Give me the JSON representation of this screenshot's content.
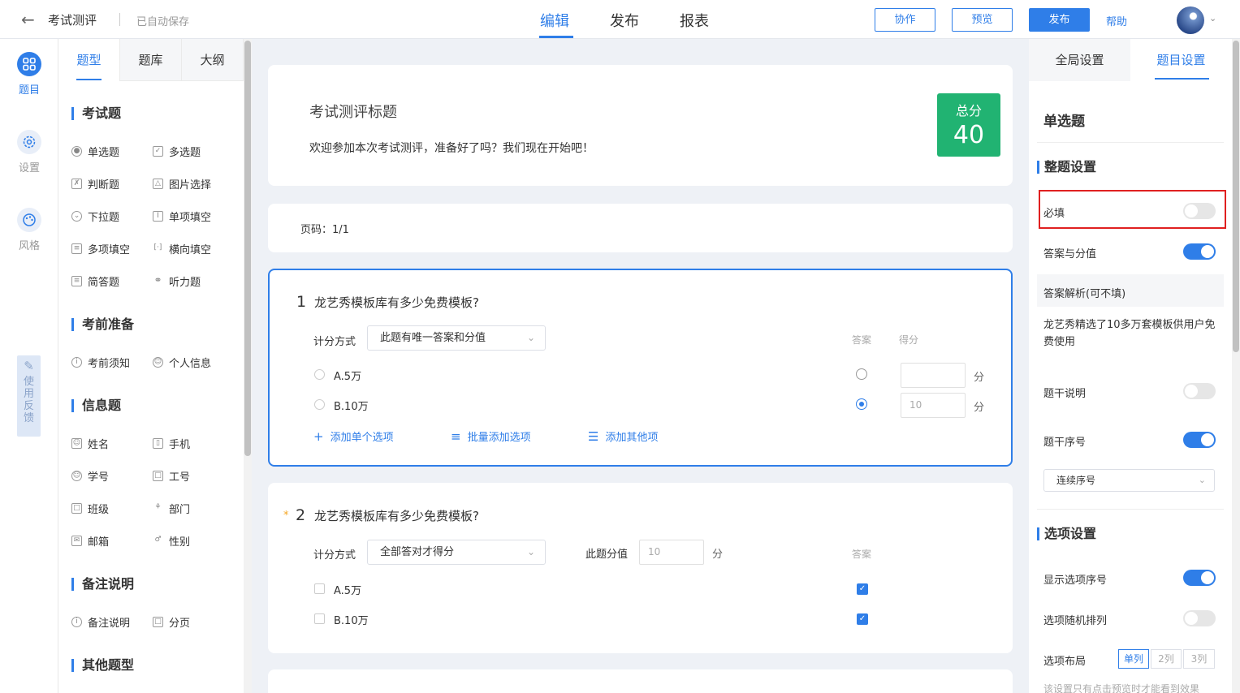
{
  "header": {
    "title": "考试测评",
    "saved": "已自动保存",
    "tabs": [
      "编辑",
      "发布",
      "报表"
    ],
    "buttons": {
      "collab": "协作",
      "preview": "预览",
      "publish": "发布",
      "help": "帮助"
    },
    "accent": "#2f7ee8"
  },
  "rail": {
    "items": [
      {
        "label": "题目"
      },
      {
        "label": "设置"
      },
      {
        "label": "风格"
      }
    ],
    "feedback": "使用反馈"
  },
  "qpanel": {
    "tabs": [
      "题型",
      "题库",
      "大纲"
    ],
    "sections": [
      {
        "title": "考试题",
        "items": [
          "单选题",
          "多选题",
          "判断题",
          "图片选择",
          "下拉题",
          "单项填空",
          "多项填空",
          "横向填空",
          "简答题",
          "听力题"
        ]
      },
      {
        "title": "考前准备",
        "items": [
          "考前须知",
          "个人信息"
        ]
      },
      {
        "title": "信息题",
        "items": [
          "姓名",
          "手机",
          "学号",
          "工号",
          "班级",
          "部门",
          "邮箱",
          "性别"
        ]
      },
      {
        "title": "备注说明",
        "items": [
          "备注说明",
          "分页"
        ]
      },
      {
        "title": "其他题型",
        "items": []
      }
    ]
  },
  "survey": {
    "title": "考试测评标题",
    "welcome": "欢迎参加本次考试测评，准备好了吗？我们现在开始吧！",
    "score_label": "总分",
    "score_value": "40",
    "score_color": "#21b372",
    "page": "页码：1/1"
  },
  "questions": [
    {
      "num": "1",
      "text": "龙艺秀模板库有多少免费模板?",
      "scoring_label": "计分方式",
      "scoring_value": "此题有唯一答案和分值",
      "col_answer": "答案",
      "col_score": "得分",
      "options": [
        {
          "text": "A.5万",
          "correct": false,
          "score": ""
        },
        {
          "text": "B.10万",
          "correct": true,
          "score": "10"
        }
      ],
      "unit": "分",
      "actions": [
        "添加单个选项",
        "批量添加选项",
        "添加其他项"
      ]
    },
    {
      "num": "2",
      "required_mark": "*",
      "text": "龙艺秀模板库有多少免费模板?",
      "scoring_label": "计分方式",
      "scoring_value": "全部答对才得分",
      "points_label": "此题分值",
      "points_value": "10",
      "unit": "分",
      "col_answer": "答案",
      "options": [
        {
          "text": "A.5万",
          "correct": true
        },
        {
          "text": "B.10万",
          "correct": true
        }
      ]
    }
  ],
  "settings": {
    "tabs": [
      "全局设置",
      "题目设置"
    ],
    "type": "单选题",
    "whole_section": "整题设置",
    "required": {
      "label": "必填",
      "on": false
    },
    "answer_score": {
      "label": "答案与分值",
      "on": true
    },
    "analysis_label": "答案解析(可不填)",
    "analysis_text": "龙艺秀精选了10多万套模板供用户免费使用",
    "stem_note": {
      "label": "题干说明",
      "on": false
    },
    "stem_number": {
      "label": "题干序号",
      "on": true
    },
    "numbering_select": "连续序号",
    "option_section": "选项设置",
    "show_option_number": {
      "label": "显示选项序号",
      "on": true
    },
    "random_order": {
      "label": "选项随机排列",
      "on": false
    },
    "layout_label": "选项布局",
    "layout_options": [
      "单列",
      "2列",
      "3列"
    ],
    "layout_selected": "单列",
    "note": "该设置只有点击预览时才能看到效果"
  }
}
